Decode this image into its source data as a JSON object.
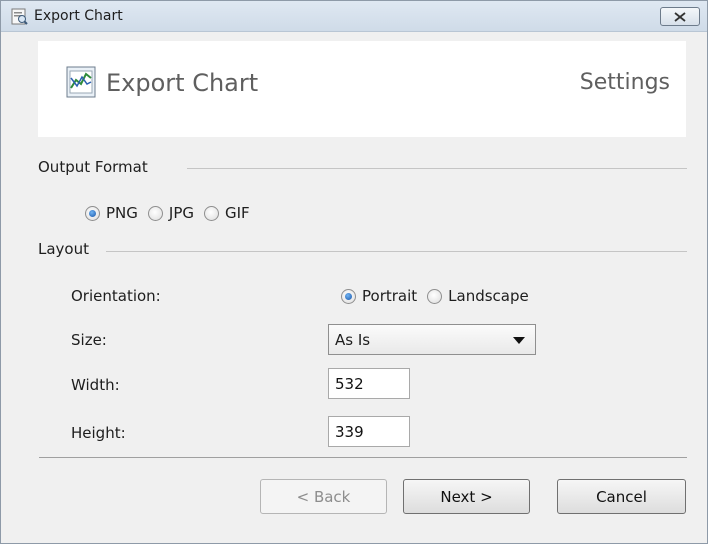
{
  "window": {
    "title": "Export Chart",
    "close_icon": "close-icon"
  },
  "header": {
    "title": "Export Chart",
    "step": "Settings",
    "icon": "chart-icon"
  },
  "output_format": {
    "label": "Output Format",
    "options": [
      {
        "label": "PNG",
        "selected": true
      },
      {
        "label": "JPG",
        "selected": false
      },
      {
        "label": "GIF",
        "selected": false
      }
    ]
  },
  "layout": {
    "label": "Layout",
    "orientation": {
      "label": "Orientation:",
      "options": [
        {
          "label": "Portrait",
          "selected": true
        },
        {
          "label": "Landscape",
          "selected": false
        }
      ]
    },
    "size": {
      "label": "Size:",
      "value": "As Is"
    },
    "width": {
      "label": "Width:",
      "value": "532"
    },
    "height": {
      "label": "Height:",
      "value": "339"
    }
  },
  "buttons": {
    "back": "< Back",
    "next": "Next >",
    "cancel": "Cancel"
  }
}
